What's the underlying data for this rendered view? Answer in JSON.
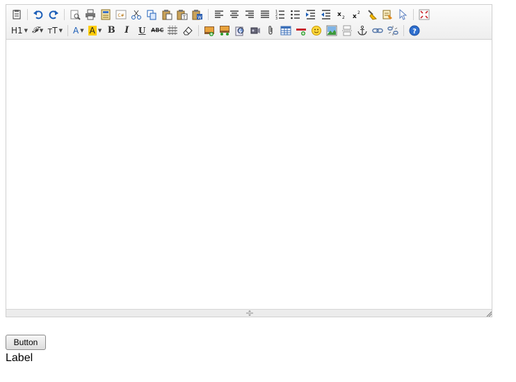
{
  "toolbar": {
    "row1": [
      {
        "name": "paste-source-icon",
        "kind": "icon"
      },
      {
        "kind": "sep"
      },
      {
        "name": "undo-icon",
        "kind": "icon"
      },
      {
        "name": "redo-icon",
        "kind": "icon"
      },
      {
        "kind": "sep"
      },
      {
        "name": "preview-icon",
        "kind": "icon"
      },
      {
        "name": "print-icon",
        "kind": "icon"
      },
      {
        "name": "template-icon",
        "kind": "icon"
      },
      {
        "name": "insert-code-icon",
        "kind": "icon",
        "text": "C#"
      },
      {
        "name": "cut-icon",
        "kind": "icon"
      },
      {
        "name": "copy-icon",
        "kind": "icon"
      },
      {
        "name": "paste-icon",
        "kind": "icon"
      },
      {
        "name": "paste-text-icon",
        "kind": "icon"
      },
      {
        "name": "paste-word-icon",
        "kind": "icon"
      },
      {
        "kind": "sep"
      },
      {
        "name": "align-left-icon",
        "kind": "icon"
      },
      {
        "name": "align-center-icon",
        "kind": "icon"
      },
      {
        "name": "align-right-icon",
        "kind": "icon"
      },
      {
        "name": "align-justify-icon",
        "kind": "icon"
      },
      {
        "name": "ordered-list-icon",
        "kind": "icon"
      },
      {
        "name": "unordered-list-icon",
        "kind": "icon"
      },
      {
        "name": "indent-icon",
        "kind": "icon"
      },
      {
        "name": "outdent-icon",
        "kind": "icon"
      },
      {
        "name": "subscript-icon",
        "kind": "icon",
        "text": "x₂"
      },
      {
        "name": "superscript-icon",
        "kind": "icon",
        "text": "x²"
      },
      {
        "name": "clear-format-icon",
        "kind": "icon"
      },
      {
        "name": "select-all-icon",
        "kind": "icon"
      },
      {
        "name": "select-pointer-icon",
        "kind": "icon"
      },
      {
        "kind": "sep"
      },
      {
        "name": "fullscreen-icon",
        "kind": "icon"
      }
    ],
    "row2": [
      {
        "name": "heading-dropdown",
        "kind": "combo",
        "text": "H1"
      },
      {
        "name": "font-family-dropdown",
        "kind": "combo",
        "text": "𝓕"
      },
      {
        "name": "font-size-dropdown",
        "kind": "combo",
        "text": "ᴛT"
      },
      {
        "kind": "sep"
      },
      {
        "name": "font-color-dropdown",
        "kind": "combo",
        "text": "A"
      },
      {
        "name": "back-color-dropdown",
        "kind": "combo",
        "text": "A",
        "highlight": "#ffcc00"
      },
      {
        "name": "bold-button",
        "kind": "text",
        "text": "B",
        "style": "bold"
      },
      {
        "name": "italic-button",
        "kind": "text",
        "text": "I",
        "style": "ital"
      },
      {
        "name": "underline-button",
        "kind": "text",
        "text": "U",
        "style": "und"
      },
      {
        "name": "strikethrough-button",
        "kind": "text",
        "text": "ABC",
        "style": "abc"
      },
      {
        "name": "insert-table-grid-icon",
        "kind": "icon"
      },
      {
        "name": "eraser-icon",
        "kind": "icon"
      },
      {
        "kind": "sep"
      },
      {
        "name": "insert-image-icon",
        "kind": "icon"
      },
      {
        "name": "insert-gallery-icon",
        "kind": "icon"
      },
      {
        "name": "insert-flash-icon",
        "kind": "icon"
      },
      {
        "name": "insert-media-icon",
        "kind": "icon"
      },
      {
        "name": "attachment-icon",
        "kind": "icon"
      },
      {
        "name": "insert-table-icon",
        "kind": "icon"
      },
      {
        "name": "horizontal-rule-icon",
        "kind": "icon"
      },
      {
        "name": "emoticon-icon",
        "kind": "icon"
      },
      {
        "name": "image-map-icon",
        "kind": "icon"
      },
      {
        "name": "page-break-icon",
        "kind": "icon"
      },
      {
        "name": "anchor-icon",
        "kind": "icon"
      },
      {
        "name": "link-icon",
        "kind": "icon"
      },
      {
        "name": "unlink-icon",
        "kind": "icon"
      },
      {
        "kind": "sep"
      },
      {
        "name": "help-icon",
        "kind": "icon"
      }
    ]
  },
  "button": {
    "label": "Button"
  },
  "label": {
    "text": "Label"
  },
  "colors": {
    "toolbar_bg": "#eeeeee",
    "border": "#cfcfcf",
    "accent_blue": "#1d5fb8",
    "highlight_yellow": "#ffcc00"
  }
}
